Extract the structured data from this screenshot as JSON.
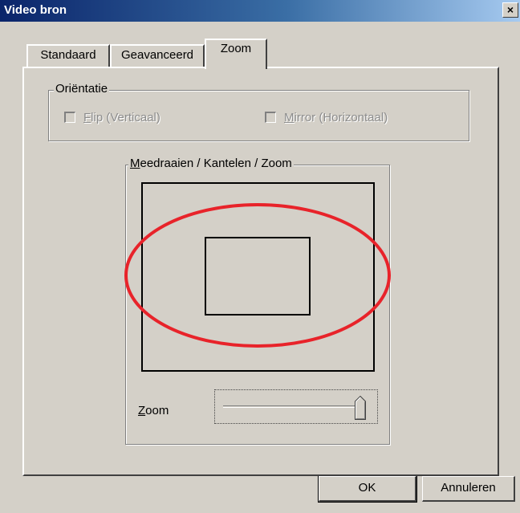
{
  "window": {
    "title": "Video bron",
    "close_glyph": "×"
  },
  "tabs": [
    {
      "label": "Standaard",
      "active": false
    },
    {
      "label": "Geavanceerd",
      "active": false
    },
    {
      "label": "Zoom",
      "active": true
    }
  ],
  "orientation": {
    "legend": "Oriëntatie",
    "flip": {
      "accel": "F",
      "rest": "lip (Verticaal)",
      "checked": false,
      "enabled": false
    },
    "mirror": {
      "accel": "M",
      "rest": "irror (Horizontaal)",
      "checked": false,
      "enabled": false
    }
  },
  "pan_tilt": {
    "legend_accel": "M",
    "legend_rest": "eedraaien / Kantelen / Zoom",
    "zoom_label_accel": "Z",
    "zoom_label_rest": "oom",
    "zoom_level_fraction": 1.0
  },
  "annotation": {
    "color": "#e8232a"
  },
  "buttons": {
    "ok": "OK",
    "cancel": "Annuleren"
  },
  "icons": {
    "close": "close-icon",
    "slider_thumb": "slider-thumb-icon"
  }
}
